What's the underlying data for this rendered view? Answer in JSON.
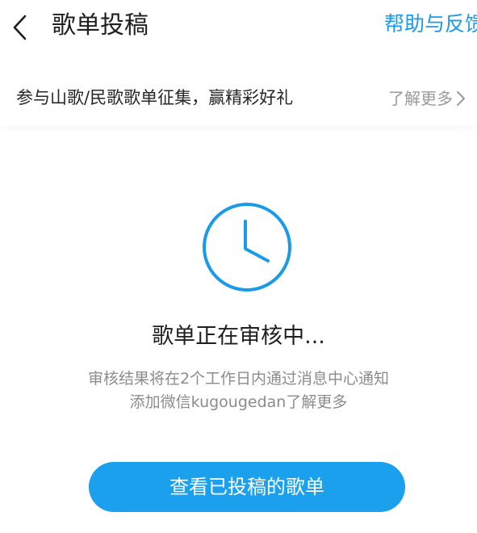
{
  "header": {
    "title": "歌单投稿",
    "help_label": "帮助与反馈",
    "back_icon": "chevron-left-icon"
  },
  "banner": {
    "text": "参与山歌/民歌歌单征集，赢精彩好礼",
    "more_label": "了解更多",
    "more_icon": "chevron-right-icon"
  },
  "status": {
    "icon": "clock-icon",
    "title": "歌单正在审核中...",
    "desc_line1": "审核结果将在2个工作日内通过消息中心通知",
    "desc_line2": "添加微信kugougedan了解更多"
  },
  "action": {
    "view_label": "查看已投稿的歌单"
  },
  "colors": {
    "accent": "#1a9ae8",
    "button": "#1aa0ed",
    "muted": "#9a9a9a"
  }
}
